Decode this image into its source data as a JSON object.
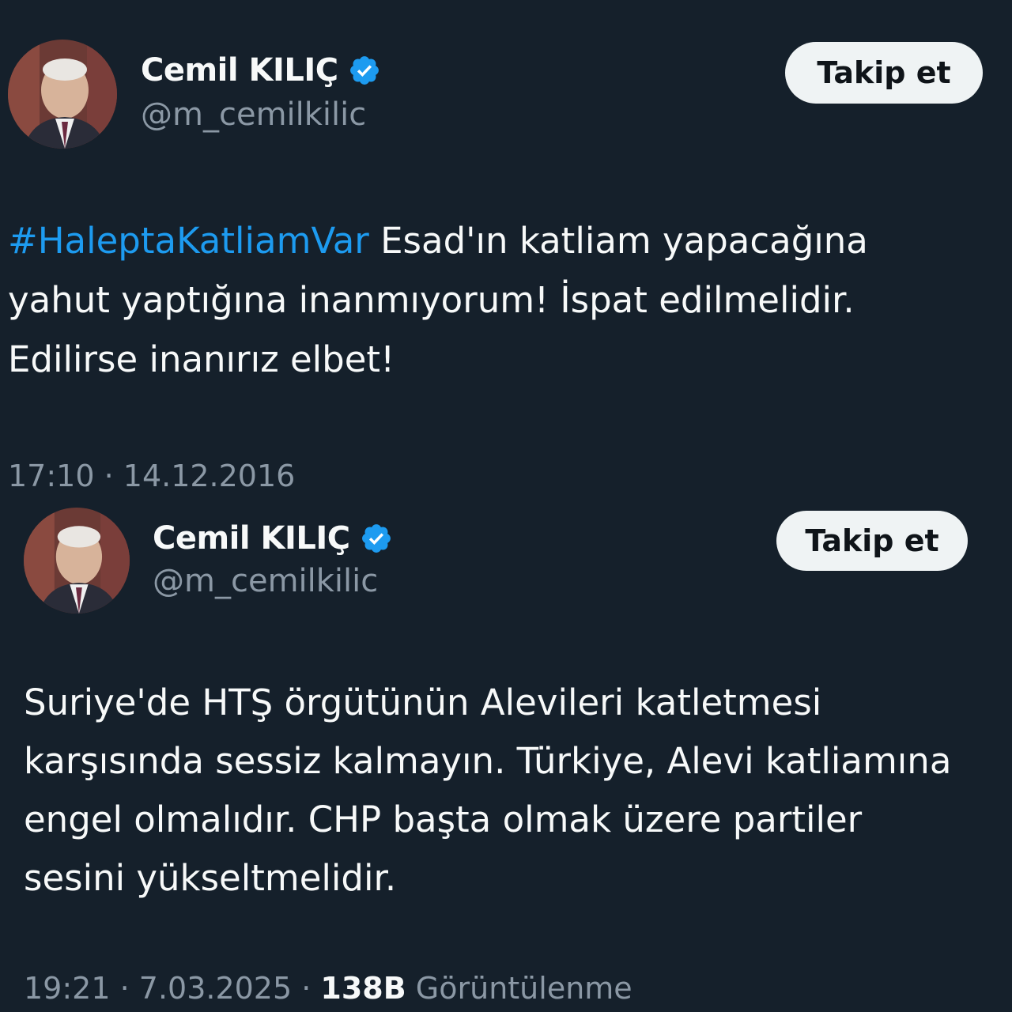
{
  "tweets": [
    {
      "display_name": "Cemil KILIÇ",
      "handle": "@m_cemilkilic",
      "follow_label": "Takip et",
      "hashtag": "#HaleptaKatliamVar",
      "text_line1_rest": " Esad'ın katliam yapacağına",
      "text_line2": "yahut yaptığına inanmıyorum! İspat edilmelidir.",
      "text_line3": "Edilirse inanırız elbet!",
      "time": "17:10",
      "separator": " · ",
      "date": "14.12.2016"
    },
    {
      "display_name": "Cemil KILIÇ",
      "handle": "@m_cemilkilic",
      "follow_label": "Takip et",
      "text_lines": [
        "Suriye'de HTŞ örgütünün Alevileri katletmesi",
        "karşısında sessiz kalmayın. Türkiye, Alevi katliamına",
        "engel olmalıdır. CHP başta olmak üzere partiler",
        "sesini yükseltmelidir."
      ],
      "time": "19:21",
      "separator": " · ",
      "date": "7.03.2025",
      "views_count": "138B",
      "views_label": " Görüntülenme"
    }
  ],
  "colors": {
    "background": "#15202b",
    "text": "#f7f9f9",
    "secondary": "#8b98a5",
    "accent": "#1d9bf0",
    "button_bg": "#eff3f4"
  },
  "icons": {
    "verified": "verified-badge-icon",
    "avatar": "profile-photo"
  }
}
